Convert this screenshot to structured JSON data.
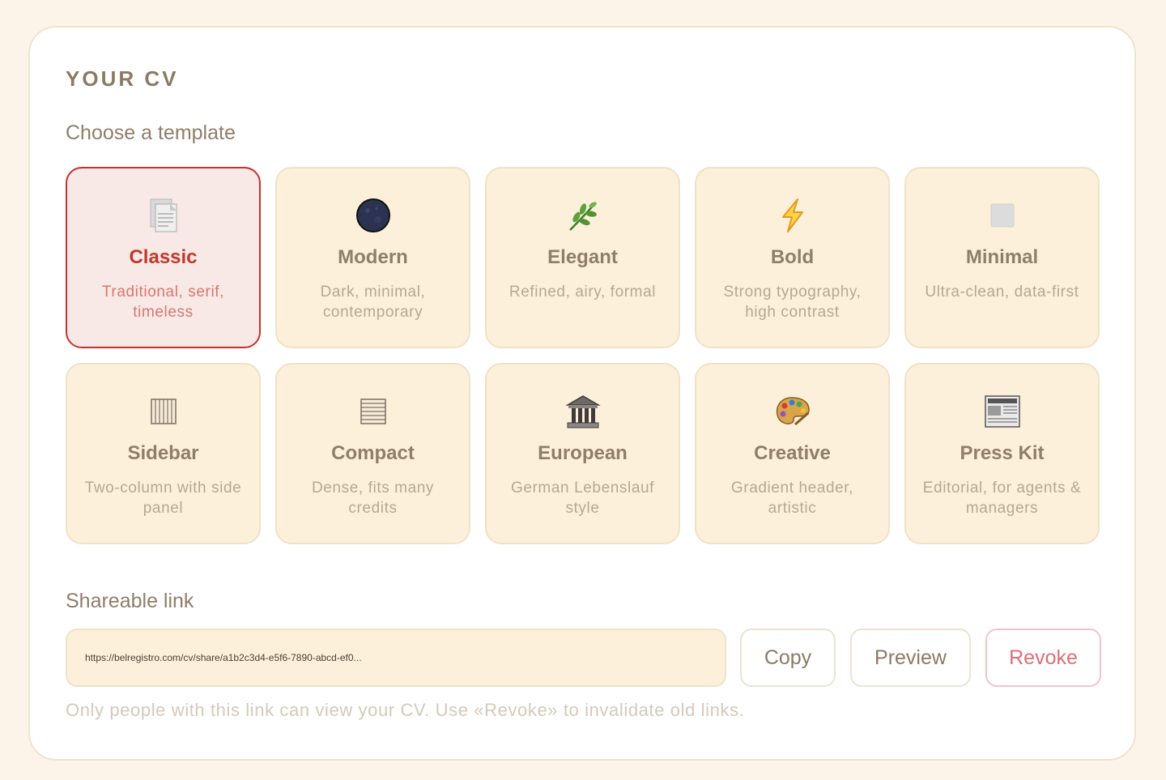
{
  "section": {
    "title": "YOUR CV",
    "templates_heading": "Choose a template",
    "share_heading": "Shareable link"
  },
  "templates": [
    {
      "name": "Classic",
      "desc": "Traditional, serif, timeless",
      "icon": "page-icon",
      "selected": true
    },
    {
      "name": "Modern",
      "desc": "Dark, minimal, contemporary",
      "icon": "new-moon-icon"
    },
    {
      "name": "Elegant",
      "desc": "Refined, airy, formal",
      "icon": "herb-icon"
    },
    {
      "name": "Bold",
      "desc": "Strong typography, high contrast",
      "icon": "lightning-icon"
    },
    {
      "name": "Minimal",
      "desc": "Ultra-clean, data-first",
      "icon": "square-icon"
    },
    {
      "name": "Sidebar",
      "desc": "Two-column with side panel",
      "icon": "columns-icon"
    },
    {
      "name": "Compact",
      "desc": "Dense, fits many credits",
      "icon": "rows-icon"
    },
    {
      "name": "European",
      "desc": "German Lebenslauf style",
      "icon": "classical-building-icon"
    },
    {
      "name": "Creative",
      "desc": "Gradient header, artistic",
      "icon": "palette-icon"
    },
    {
      "name": "Press Kit",
      "desc": "Editorial, for agents & managers",
      "icon": "newspaper-icon"
    }
  ],
  "share": {
    "url": "https://belregistro.com/cv/share/a1b2c3d4-e5f6-7890-abcd-ef0...",
    "copy_label": "Copy",
    "preview_label": "Preview",
    "revoke_label": "Revoke",
    "note": "Only people with this link can view your CV. Use «Revoke» to invalidate old links."
  },
  "colors": {
    "accent": "#c0392b",
    "card_bg": "#fdf0da",
    "page_bg": "#fdf4e9",
    "revoke": "#e06d77"
  }
}
